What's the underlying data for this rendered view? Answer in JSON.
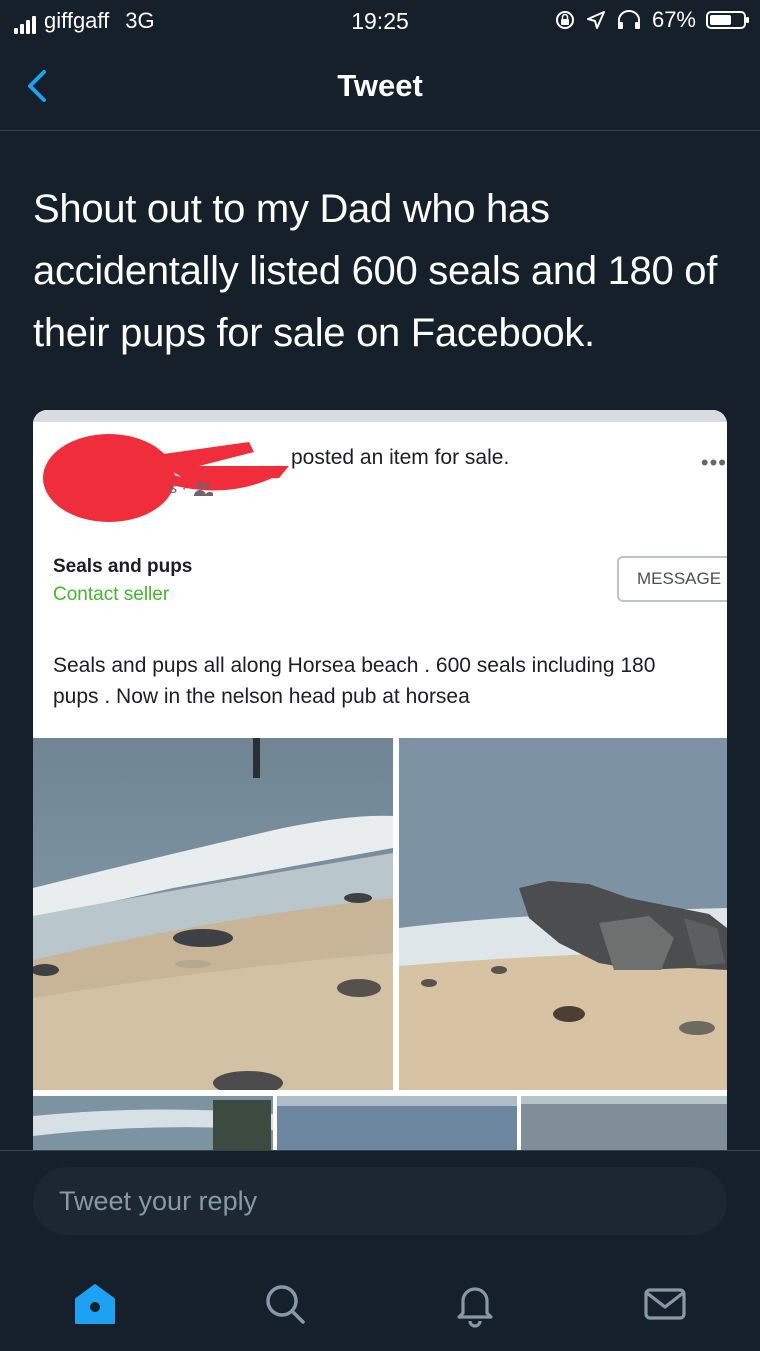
{
  "status_bar": {
    "carrier": "giffgaff",
    "network": "3G",
    "time": "19:25",
    "battery": "67%",
    "battery_level": 0.67,
    "icons": [
      "signal-icon",
      "rotation-lock-icon",
      "location-icon",
      "headphones-icon",
      "battery-icon"
    ]
  },
  "nav": {
    "title": "Tweet",
    "back_icon": "chevron-left-icon"
  },
  "tweet": {
    "text": "Shout out to my Dad who has accidentally listed 600 seals and 180 of their pups for sale on Facebook."
  },
  "embedded_post": {
    "action_text": "posted an item for sale.",
    "meta_visible": "s ·",
    "item_title": "Seals and pups",
    "contact_label": "Contact seller",
    "message_button": "MESSAGE",
    "description": "Seals and pups all along Horsea beach . 600 seals including 180\npups . Now in the nelson head pub at horsea",
    "more_icon": "more-dots-icon",
    "audience_icon": "friends-icon"
  },
  "reply": {
    "placeholder": "Tweet your reply"
  },
  "tab_bar": {
    "items": [
      "home-icon",
      "search-icon",
      "notifications-icon",
      "messages-icon"
    ],
    "accent_color": "#1da1f2"
  },
  "colors": {
    "background": "#15202b",
    "divider": "#38444d",
    "contact_green": "#42b72a",
    "redaction": "#f02d3a"
  }
}
